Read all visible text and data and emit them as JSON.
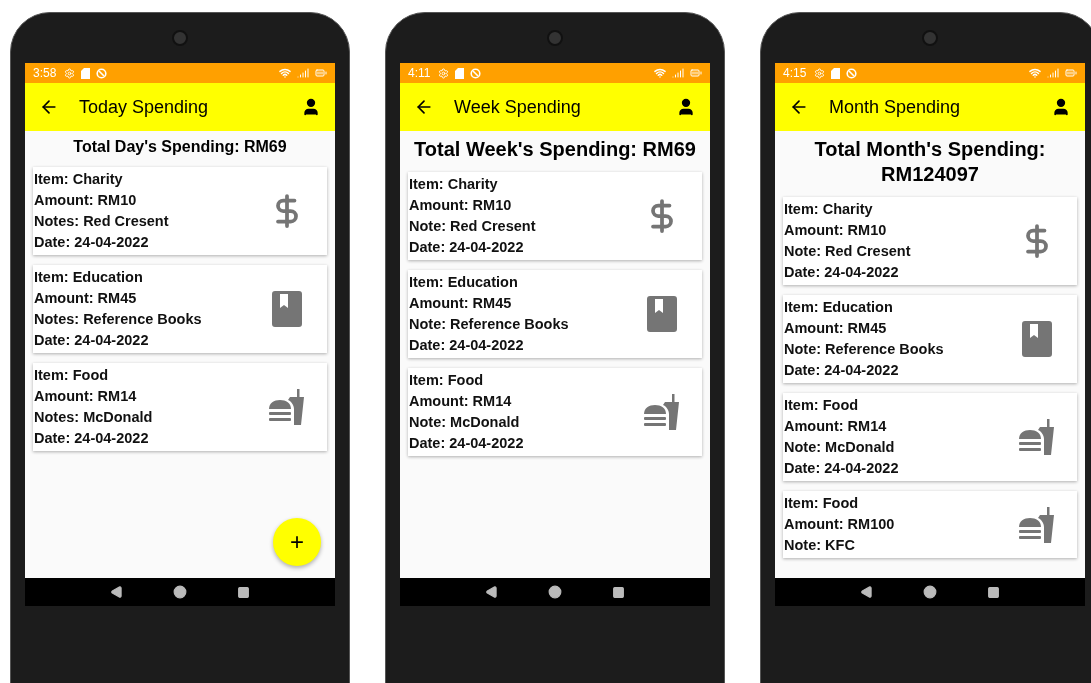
{
  "phones": [
    {
      "status_time": "3:58",
      "title": "Today Spending",
      "total": "Total Day's Spending: RM69",
      "cards": [
        {
          "kind": "dollar",
          "lines": [
            "Item: Charity",
            "Amount: RM10",
            "Notes: Red Cresent",
            "Date: 24-04-2022"
          ]
        },
        {
          "kind": "book",
          "lines": [
            "Item: Education",
            "Amount: RM45",
            "Notes: Reference Books",
            "Date: 24-04-2022"
          ]
        },
        {
          "kind": "food",
          "lines": [
            "Item: Food",
            "Amount: RM14",
            "Notes: McDonald",
            "Date: 24-04-2022"
          ]
        }
      ],
      "fab": "+"
    },
    {
      "status_time": "4:11",
      "title": "Week Spending",
      "total": "Total Week's Spending: RM69",
      "cards": [
        {
          "kind": "dollar",
          "lines": [
            "Item: Charity",
            "Amount: RM10",
            "Note: Red Cresent",
            "Date: 24-04-2022"
          ]
        },
        {
          "kind": "book",
          "lines": [
            "Item: Education",
            "Amount: RM45",
            "Note: Reference Books",
            "Date: 24-04-2022"
          ]
        },
        {
          "kind": "food",
          "lines": [
            "Item: Food",
            "Amount: RM14",
            "Note: McDonald",
            "Date: 24-04-2022"
          ]
        }
      ]
    },
    {
      "status_time": "4:15",
      "title": "Month Spending",
      "total": "Total Month's Spending: RM124097",
      "cards": [
        {
          "kind": "dollar",
          "lines": [
            "Item: Charity",
            "Amount: RM10",
            "Note: Red Cresent",
            "Date: 24-04-2022"
          ]
        },
        {
          "kind": "book",
          "lines": [
            "Item: Education",
            "Amount: RM45",
            "Note: Reference Books",
            "Date: 24-04-2022"
          ]
        },
        {
          "kind": "food",
          "lines": [
            "Item: Food",
            "Amount: RM14",
            "Note: McDonald",
            "Date: 24-04-2022"
          ]
        },
        {
          "kind": "food",
          "lines": [
            "Item: Food",
            "Amount: RM100",
            "Note: KFC"
          ]
        }
      ]
    }
  ]
}
